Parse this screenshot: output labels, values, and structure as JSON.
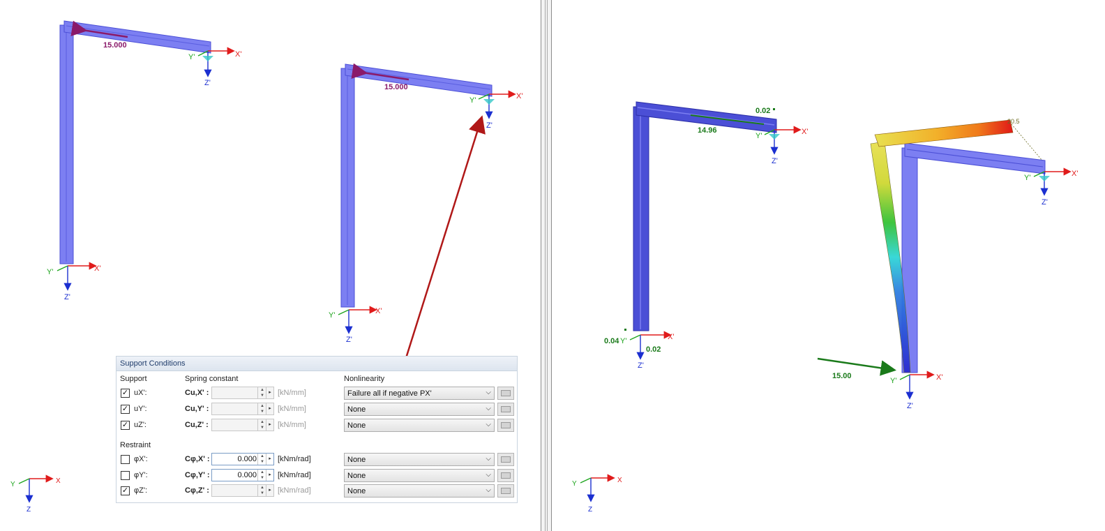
{
  "left_view": {
    "frame1": {
      "load": "15.000",
      "axes": {
        "x": "X'",
        "y": "Y'",
        "z": "Z'"
      }
    },
    "frame2": {
      "load": "15.000",
      "axes": {
        "x": "X'",
        "y": "Y'",
        "z": "Z'"
      }
    },
    "global_axes": {
      "x": "X",
      "y": "Y",
      "z": "Z"
    }
  },
  "right_view": {
    "frame1": {
      "value_top": "0.02",
      "value_beam": "14.96",
      "value_left": "0.04",
      "value_base": "0.02",
      "axes": {
        "x": "X'",
        "y": "Y'",
        "z": "Z'"
      }
    },
    "frame2": {
      "max_label": "20.5",
      "load": "15.00",
      "axes": {
        "x": "X'",
        "y": "Y'",
        "z": "Z'"
      }
    },
    "global_axes": {
      "x": "X",
      "y": "Y",
      "z": "Z"
    }
  },
  "panel": {
    "title": "Support Conditions",
    "col_support": "Support",
    "col_spring": "Spring constant",
    "col_nonlinearity": "Nonlinearity",
    "restraint_title": "Restraint",
    "supports": [
      {
        "checked": true,
        "dof": "uX':",
        "const": "Cu,X' :",
        "value": "",
        "unit": "[kN/mm]",
        "nonlinearity": "Failure all if negative PX'"
      },
      {
        "checked": true,
        "dof": "uY':",
        "const": "Cu,Y' :",
        "value": "",
        "unit": "[kN/mm]",
        "nonlinearity": "None"
      },
      {
        "checked": true,
        "dof": "uZ':",
        "const": "Cu,Z' :",
        "value": "",
        "unit": "[kN/mm]",
        "nonlinearity": "None"
      }
    ],
    "restraints": [
      {
        "checked": false,
        "dof": "φX':",
        "const": "Cφ,X' :",
        "value": "0.000",
        "unit": "[kNm/rad]",
        "nonlinearity": "None"
      },
      {
        "checked": false,
        "dof": "φY':",
        "const": "Cφ,Y' :",
        "value": "0.000",
        "unit": "[kNm/rad]",
        "nonlinearity": "None"
      },
      {
        "checked": true,
        "dof": "φZ':",
        "const": "Cφ,Z' :",
        "value": "",
        "unit": "[kNm/rad]",
        "nonlinearity": "None"
      }
    ]
  },
  "colors": {
    "member": "#7c7ff2",
    "member_dark": "#4b4fd6",
    "load_purple": "#8a1a6a",
    "result_green": "#1a7a1a",
    "arrow_red": "#b01818",
    "axis_x": "#e01b1b",
    "axis_y": "#1fa51f",
    "axis_z": "#1b2fd0"
  }
}
